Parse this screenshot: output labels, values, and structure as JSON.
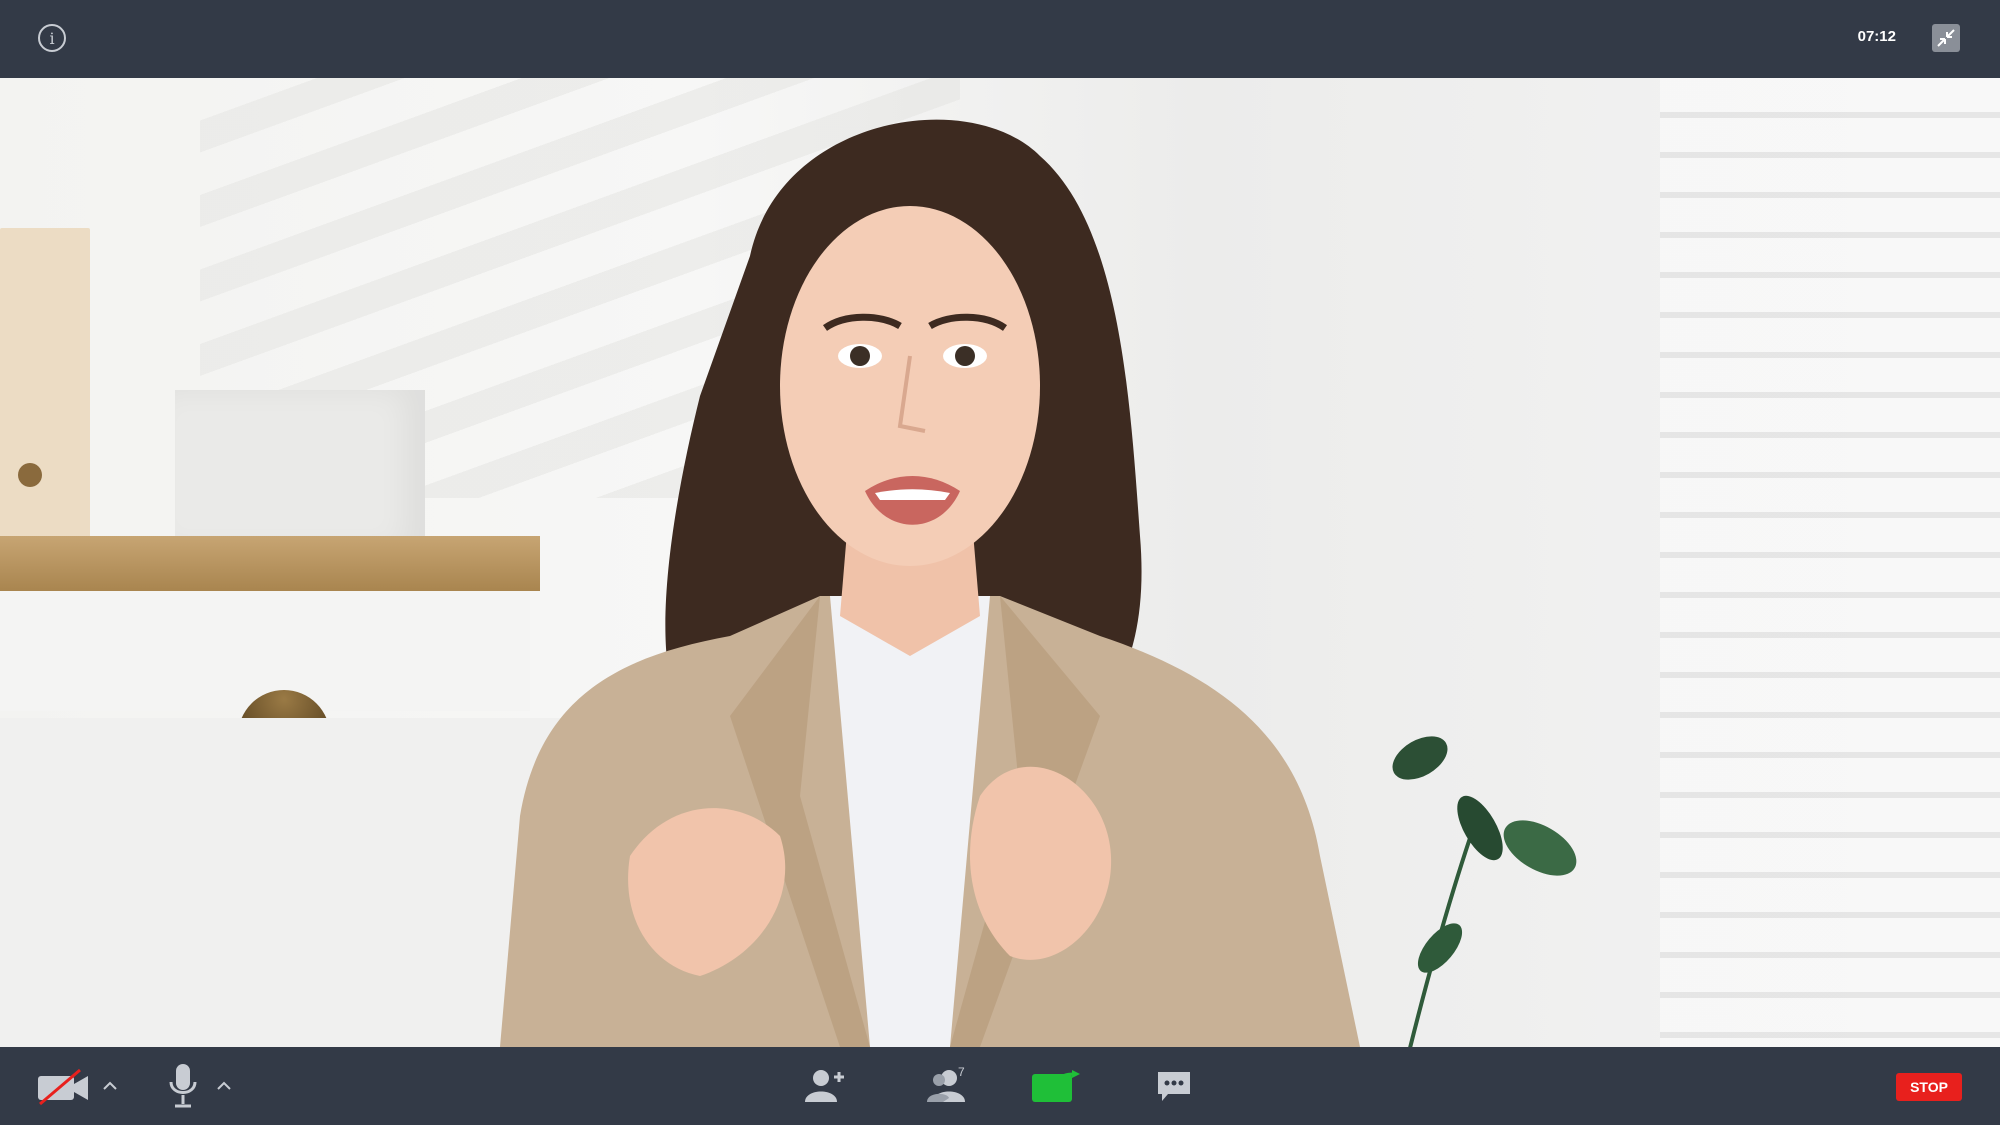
{
  "topbar": {
    "info_icon": "info-icon",
    "timer": "07:12",
    "exit_fullscreen_icon": "exit-fullscreen-icon"
  },
  "video": {
    "content": "participant-video"
  },
  "toolbar": {
    "camera_icon": "camera-off-icon",
    "mic_icon": "microphone-icon",
    "invite_icon": "add-participant-icon",
    "participants_icon": "participants-icon",
    "participants_count": "7",
    "share_icon": "share-screen-icon",
    "chat_icon": "chat-icon",
    "stop_label": "STOP"
  },
  "colors": {
    "bar_background": "#333a47",
    "stop": "#e8201d",
    "share": "#1fbf38",
    "icon": "#c8ccd3"
  }
}
